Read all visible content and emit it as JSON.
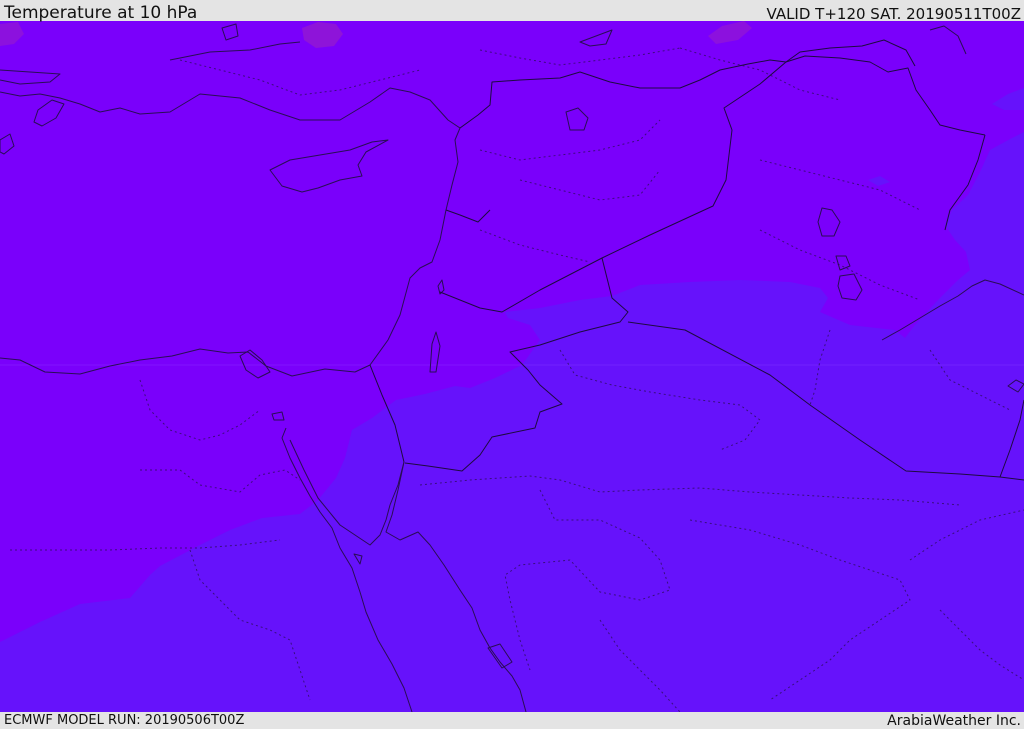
{
  "header": {
    "title": "Temperature at 10 hPa",
    "valid": "VALID T+120 SAT. 20190511T00Z"
  },
  "footer": {
    "model_run": "ECMWF MODEL RUN: 20190506T00Z",
    "credit": "ArabiaWeather Inc."
  },
  "map": {
    "colors": {
      "warm_shade": "#7a00fb",
      "cool_shade": "#6612fb",
      "warm_spot": "#9a1fc6",
      "coastline": "#2a0d55",
      "border": "#1e0a40"
    },
    "layers": [
      "temperature-shading",
      "coastlines",
      "country-borders",
      "province-borders"
    ]
  }
}
